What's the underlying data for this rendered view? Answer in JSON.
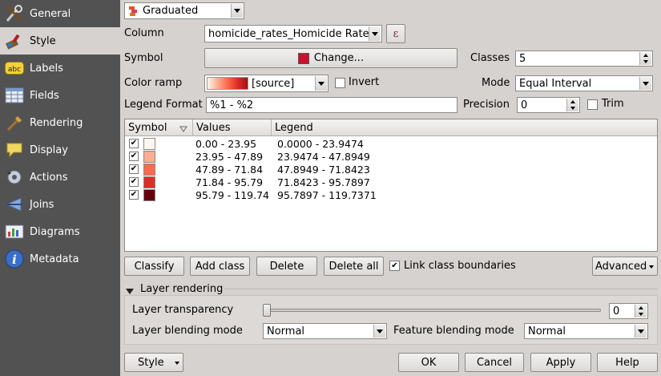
{
  "sidebar": {
    "items": [
      {
        "label": "General",
        "icon": "general-icon"
      },
      {
        "label": "Style",
        "icon": "style-icon"
      },
      {
        "label": "Labels",
        "icon": "labels-icon"
      },
      {
        "label": "Fields",
        "icon": "fields-icon"
      },
      {
        "label": "Rendering",
        "icon": "rendering-icon"
      },
      {
        "label": "Display",
        "icon": "display-icon"
      },
      {
        "label": "Actions",
        "icon": "actions-icon"
      },
      {
        "label": "Joins",
        "icon": "joins-icon"
      },
      {
        "label": "Diagrams",
        "icon": "diagrams-icon"
      },
      {
        "label": "Metadata",
        "icon": "metadata-icon"
      }
    ],
    "active_index": 1
  },
  "renderer": {
    "type": "Graduated"
  },
  "column": {
    "label": "Column",
    "value": "homicide_rates_Homicide Rate",
    "expr_button": "ε"
  },
  "symbol": {
    "label": "Symbol",
    "change_button": "Change...",
    "color": "#cc0f2a"
  },
  "classes": {
    "label": "Classes",
    "value": "5"
  },
  "color_ramp": {
    "label": "Color ramp",
    "value": "[source]",
    "invert_label": "Invert",
    "invert_checked": false
  },
  "mode": {
    "label": "Mode",
    "value": "Equal Interval"
  },
  "legend_format": {
    "label": "Legend Format",
    "value": "%1 - %2"
  },
  "precision": {
    "label": "Precision",
    "value": "0",
    "trim_label": "Trim",
    "trim_checked": false
  },
  "table": {
    "headers": [
      "Symbol",
      "Values",
      "Legend"
    ],
    "rows": [
      {
        "checked": true,
        "color": "#fff5f0",
        "values": "0.00 - 23.95",
        "legend": "0.0000 - 23.9474"
      },
      {
        "checked": true,
        "color": "#fcae91",
        "values": "23.95 - 47.89",
        "legend": "23.9474 - 47.8949"
      },
      {
        "checked": true,
        "color": "#fb6a4a",
        "values": "47.89 - 71.84",
        "legend": "47.8949 - 71.8423"
      },
      {
        "checked": true,
        "color": "#de2d26",
        "values": "71.84 - 95.79",
        "legend": "71.8423 - 95.7897"
      },
      {
        "checked": true,
        "color": "#67000d",
        "values": "95.79 - 119.74",
        "legend": "95.7897 - 119.7371"
      }
    ]
  },
  "actions": {
    "classify": "Classify",
    "add_class": "Add class",
    "delete": "Delete",
    "delete_all": "Delete all",
    "link_boundaries": "Link class boundaries",
    "link_checked": true,
    "advanced": "Advanced"
  },
  "layer_rendering": {
    "title": "Layer rendering",
    "transparency_label": "Layer transparency",
    "transparency_value": "0",
    "blending_label": "Layer blending mode",
    "blending_value": "Normal",
    "feature_blending_label": "Feature blending mode",
    "feature_blending_value": "Normal"
  },
  "footer": {
    "style": "Style",
    "ok": "OK",
    "cancel": "Cancel",
    "apply": "Apply",
    "help": "Help"
  }
}
